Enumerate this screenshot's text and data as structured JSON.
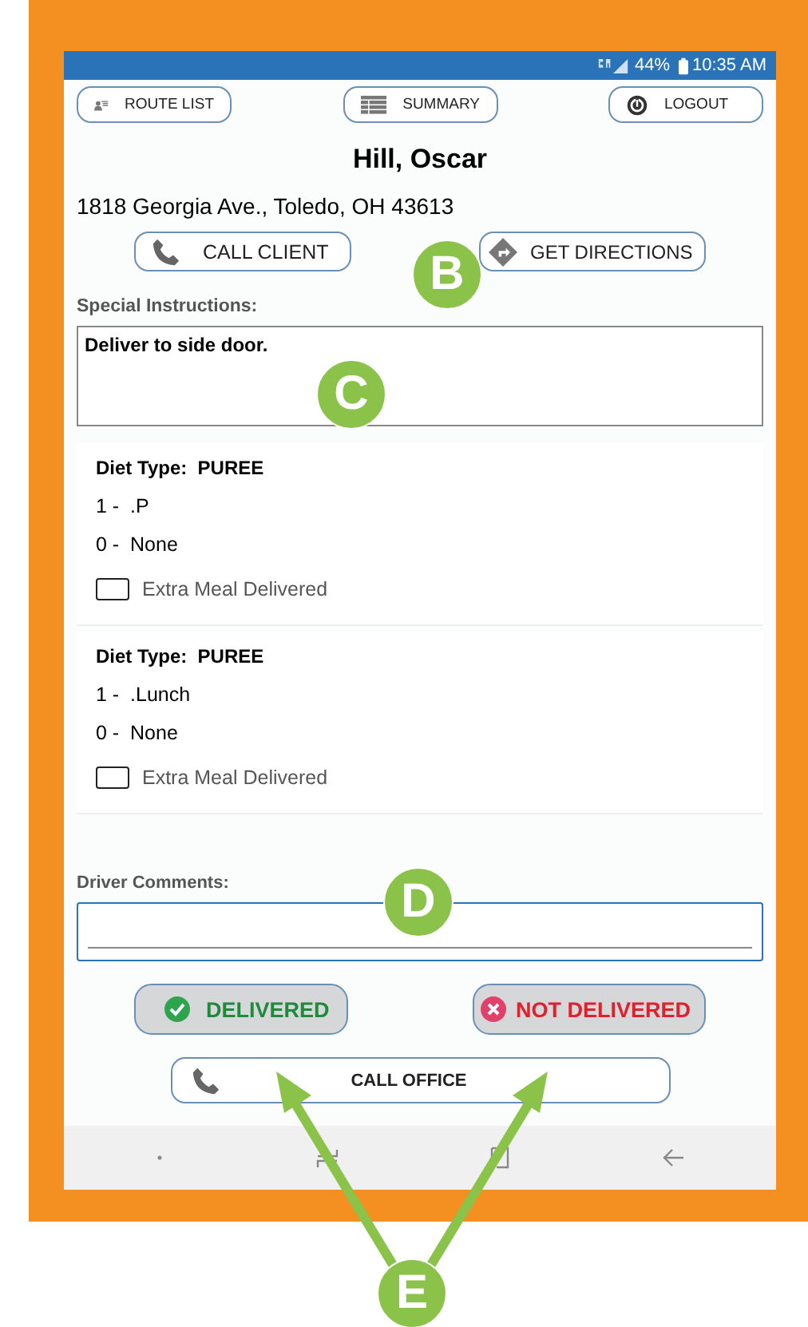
{
  "status_bar": {
    "battery": "44%",
    "time": "10:35 AM"
  },
  "top_buttons": [
    {
      "label": "ROUTE LIST",
      "kind": "route"
    },
    {
      "label": "SUMMARY",
      "kind": "summary"
    },
    {
      "label": "LOGOUT",
      "kind": "logout"
    }
  ],
  "client": {
    "name": "Hill, Oscar",
    "address": "1818 Georgia Ave., Toledo, OH 43613"
  },
  "contact_buttons": [
    {
      "label": "CALL CLIENT",
      "kind": "call"
    },
    {
      "label": "GET DIRECTIONS",
      "kind": "directions"
    }
  ],
  "special_instructions": {
    "label": "Special Instructions:",
    "value": "Deliver to side door."
  },
  "meals": [
    {
      "diet_label": "Diet Type:",
      "diet": "PUREE",
      "items": [
        "1 -  .P",
        "0 -  None"
      ],
      "extra_label": "Extra Meal Delivered",
      "checked": false
    },
    {
      "diet_label": "Diet Type:",
      "diet": "PUREE",
      "items": [
        "1 -  .Lunch",
        "0 -  None"
      ],
      "extra_label": "Extra Meal Delivered",
      "checked": false
    }
  ],
  "driver_comments": {
    "label": "Driver Comments:"
  },
  "status_buttons": [
    {
      "label": "DELIVERED",
      "kind": "delivered"
    },
    {
      "label": "NOT DELIVERED",
      "kind": "not_delivered"
    }
  ],
  "call_office": {
    "label": "CALL OFFICE"
  },
  "callouts": [
    {
      "label": "B"
    },
    {
      "label": "C"
    },
    {
      "label": "D"
    },
    {
      "label": "E"
    }
  ]
}
